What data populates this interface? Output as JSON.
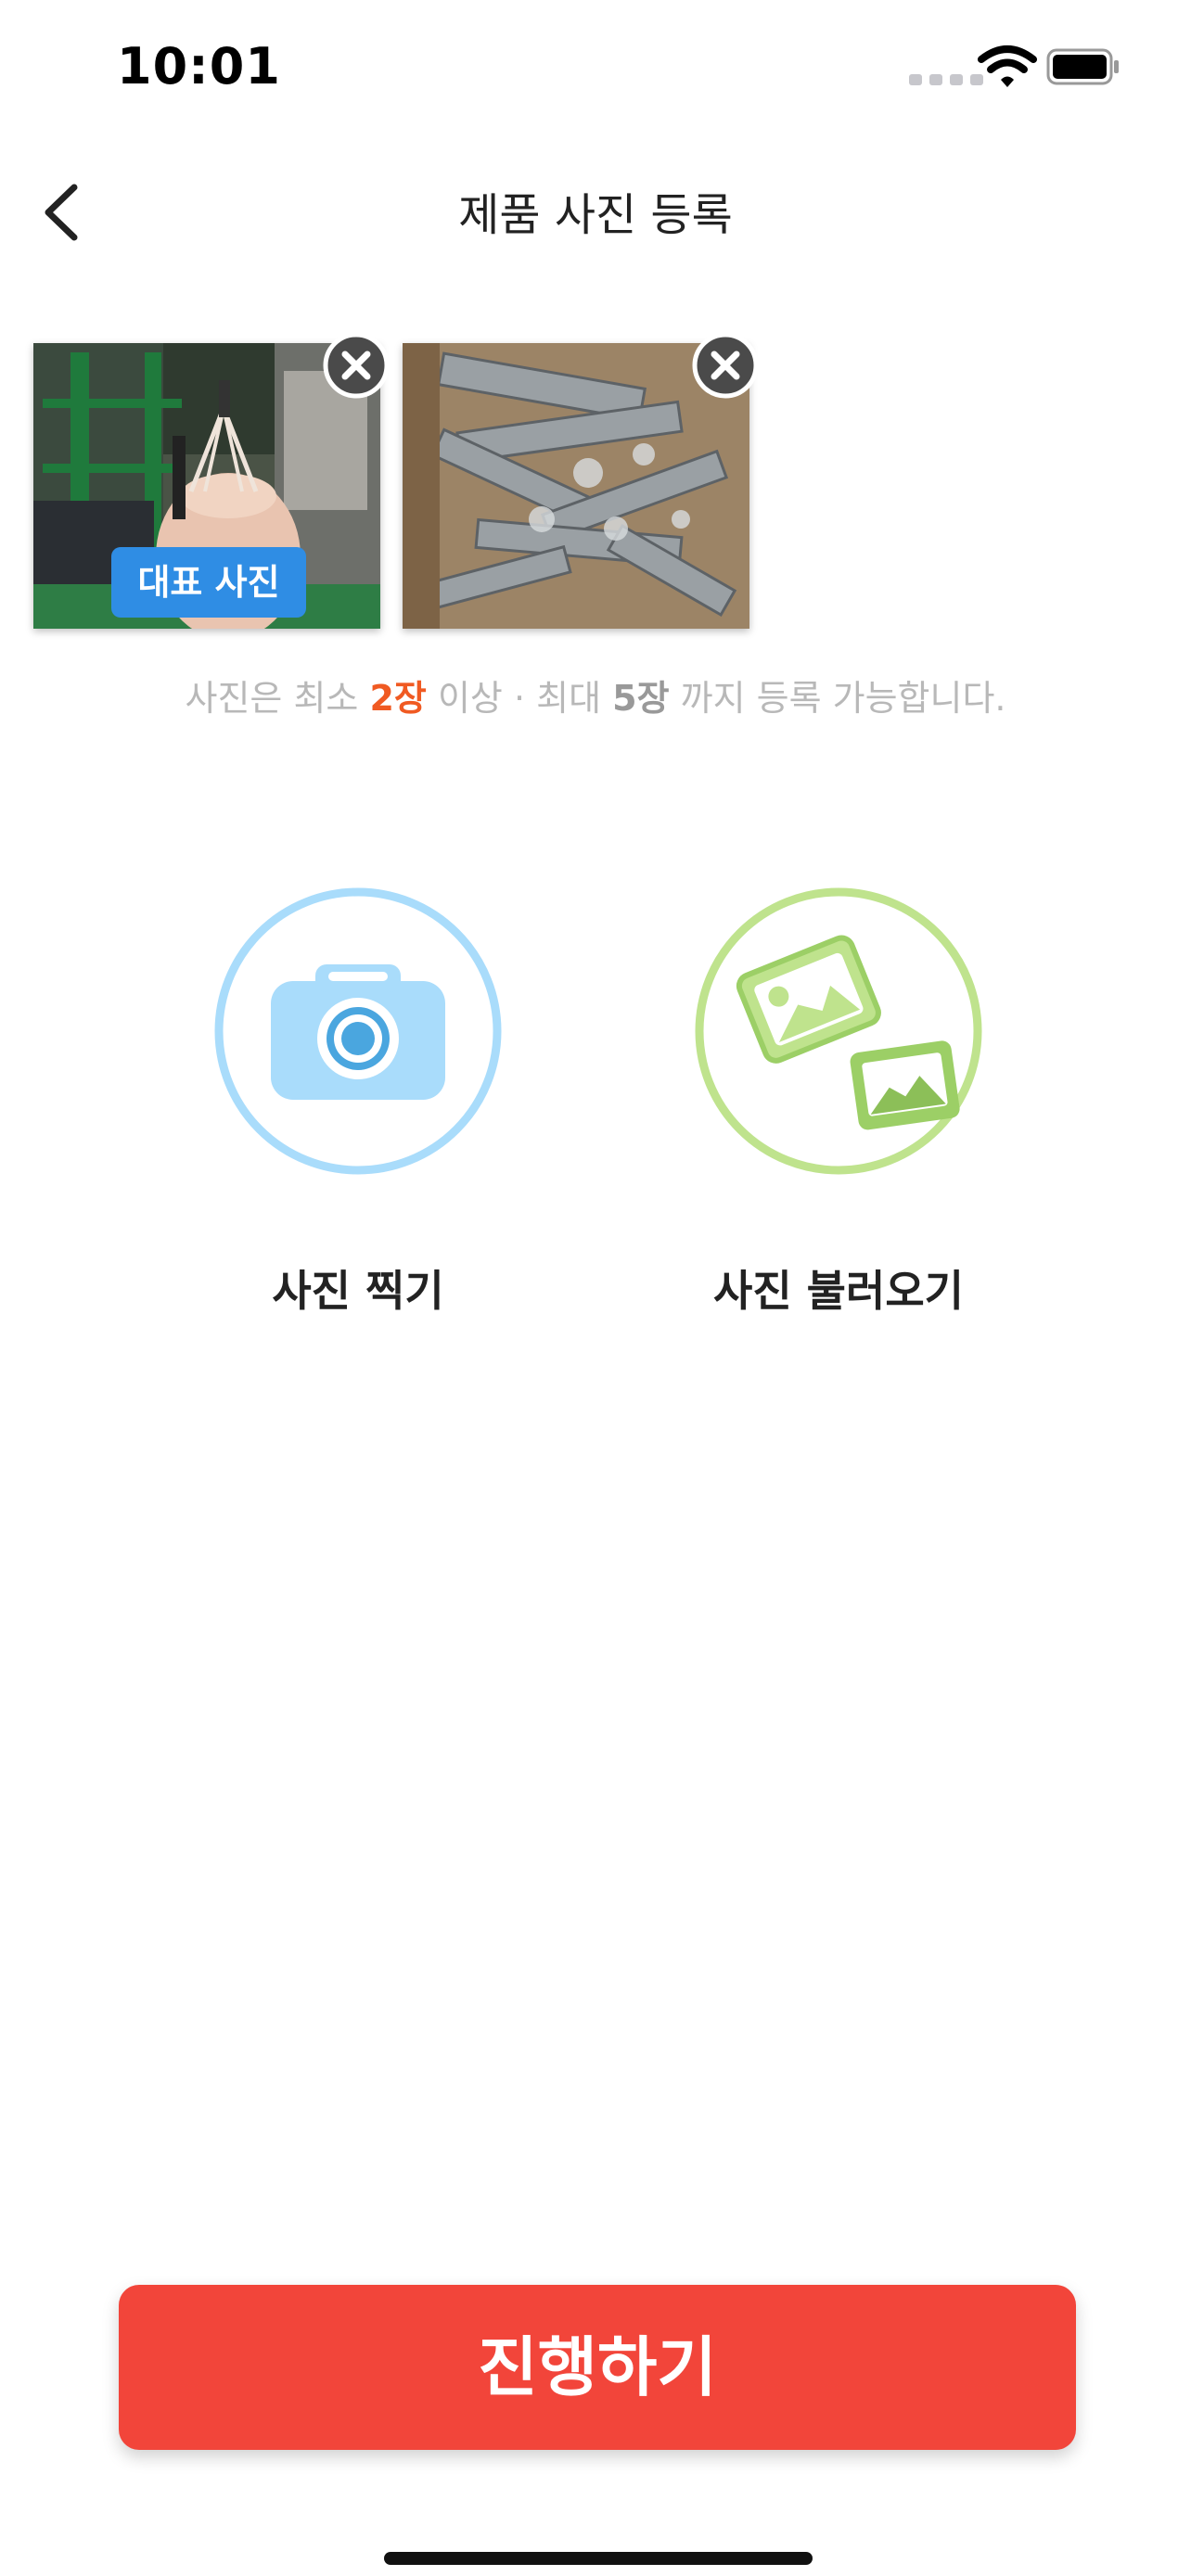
{
  "status_bar": {
    "time": "10:01"
  },
  "header": {
    "title": "제품 사진 등록"
  },
  "photos": [
    {
      "badge": "대표 사진",
      "remove_icon": "close-icon"
    },
    {
      "remove_icon": "close-icon"
    }
  ],
  "notice": {
    "part1": "사진은 최소 ",
    "min": "2장",
    "part2": " 이상 · 최대 ",
    "max": "5장",
    "part3": " 까지 등록 가능합니다."
  },
  "actions": {
    "camera_label": "사진 찍기",
    "gallery_label": "사진 불러오기"
  },
  "footer": {
    "proceed_label": "진행하기"
  },
  "colors": {
    "accent_red": "#f2453a",
    "highlight_orange": "#f05a22",
    "badge_blue": "#2f8de4",
    "camera_blue": "#a9dcfb",
    "gallery_green": "#bfe38d"
  }
}
